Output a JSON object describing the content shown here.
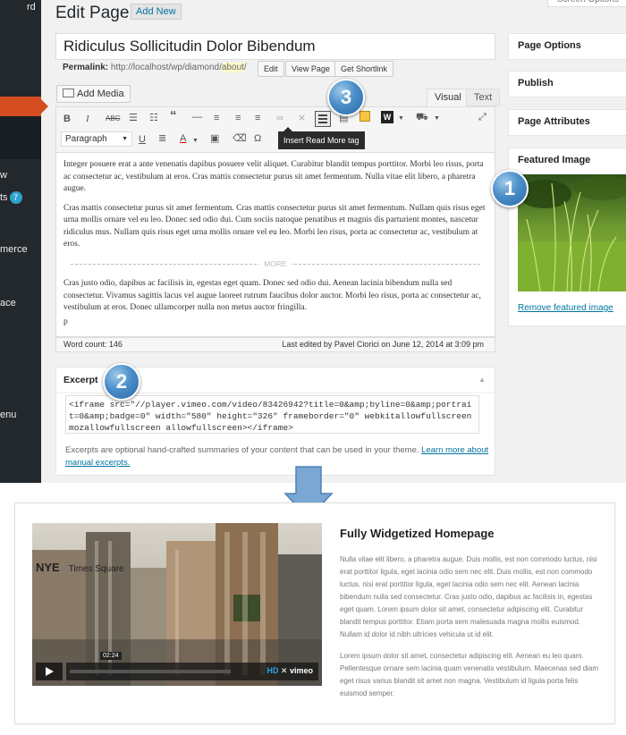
{
  "sidebar": {
    "items": [
      {
        "label": "rd"
      },
      {
        "label": "w"
      },
      {
        "label": "ts"
      },
      {
        "label": "merce"
      },
      {
        "label": "ace"
      },
      {
        "label": "enu"
      }
    ],
    "badge": "7"
  },
  "header": {
    "title": "Edit Page",
    "add_new": "Add New",
    "screen_options": "Screen Options"
  },
  "post": {
    "title": "Ridiculus Sollicitudin Dolor Bibendum",
    "permalink_label": "Permalink:",
    "permalink_base": "http://localhost/wp/diamond/",
    "permalink_slug": "about",
    "permalink_tail": "/",
    "edit_btn": "Edit",
    "view_page_btn": "View Page",
    "shortlink_btn": "Get Shortlink"
  },
  "editor": {
    "add_media": "Add Media",
    "tabs": {
      "visual": "Visual",
      "text": "Text"
    },
    "format_select": "Paragraph",
    "tooltip": "Insert Read More tag",
    "para1": "Integer posuere erat a ante venenatis dapibus posuere velit aliquet. Curabitur blandit tempus porttitor. Morbi leo risus, porta ac consectetur ac, vestibulum at eros. Cras mattis consectetur purus sit amet fermentum. Nulla vitae elit libero, a pharetra augue.",
    "para2": "Cras mattis consectetur purus sit amet fermentum. Cras mattis consectetur purus sit amet fermentum. Nullam quis risus eget urna mollis ornare vel eu leo. Donec sed odio dui. Cum sociis natoque penatibus et magnis dis parturient montes, nascetur ridiculus mus. Nullam quis risus eget urna mollis ornare vel eu leo. Morbi leo risus, porta ac consectetur ac, vestibulum at eros.",
    "more": "MORE",
    "para3": "Cras justo odio, dapibus ac facilisis in, egestas eget quam. Donec sed odio dui. Aenean lacinia bibendum nulla sed consectetur. Vivamus sagittis lacus vel augue laoreet rutrum faucibus dolor auctor. Morbi leo risus, porta ac consectetur ac, vestibulum at eros. Donec ullamcorper nulla non metus auctor fringilla.",
    "para4": "p",
    "word_count": "Word count: 146",
    "last_edited": "Last edited by Pavel Ciorici on June 12, 2014 at 3:09 pm"
  },
  "excerpt": {
    "title": "Excerpt",
    "value": "<iframe src=\"//player.vimeo.com/video/83426942?title=0&amp;byline=0&amp;portrait=0&amp;badge=0\" width=\"580\" height=\"326\" frameborder=\"0\" webkitallowfullscreen mozallowfullscreen allowfullscreen></iframe>",
    "help": "Excerpts are optional hand-crafted summaries of your content that can be used in your theme. ",
    "help_link": "Learn more about manual excerpts."
  },
  "panels": {
    "page_options": "Page Options",
    "publish": "Publish",
    "page_attributes": "Page Attributes",
    "featured_image": "Featured Image",
    "remove_featured": "Remove featured image"
  },
  "callouts": {
    "one": "1",
    "two": "2",
    "three": "3"
  },
  "preview": {
    "video_title": "NYE",
    "video_subtitle": "Times Square",
    "video_time": "02:24",
    "vimeo_hd": "HD",
    "vimeo_logo": "vimeo",
    "title": "Fully Widgetized Homepage",
    "p1": "Nulla vitae elit libero, a pharetra augue. Duis mollis, est non commodo luctus, nisi erat porttitor ligula, eget lacinia odio sem nec elit. Duis mollis, est non commodo luctus, nisi erat porttitor ligula, eget lacinia odio sem nec elit. Aenean lacinia bibendum nulla sed consectetur. Cras justo odio, dapibus ac facilisis in, egestas eget quam. Lorem ipsum dolor sit amet, consectetur adipiscing elit. Curabitur blandit tempus porttitor. Etiam porta sem malesuada magna mollis euismod. Nullam id dolor id nibh ultricies vehicula ut id elit.",
    "p2": "Lorem ipsum dolor sit amet, consectetur adipiscing elit. Aenean eu leo quam. Pellentesque ornare sem lacinia quam venenatis vestibulum. Maecenas sed diam eget risus varius blandit sit amet non magna. Vestibulum id ligula porta felis euismod semper."
  },
  "colors": {
    "admin_bar": "#23282d",
    "active_menu": "#d54e21",
    "link": "#0074a2",
    "callout_blue": "#4a8ec9"
  }
}
